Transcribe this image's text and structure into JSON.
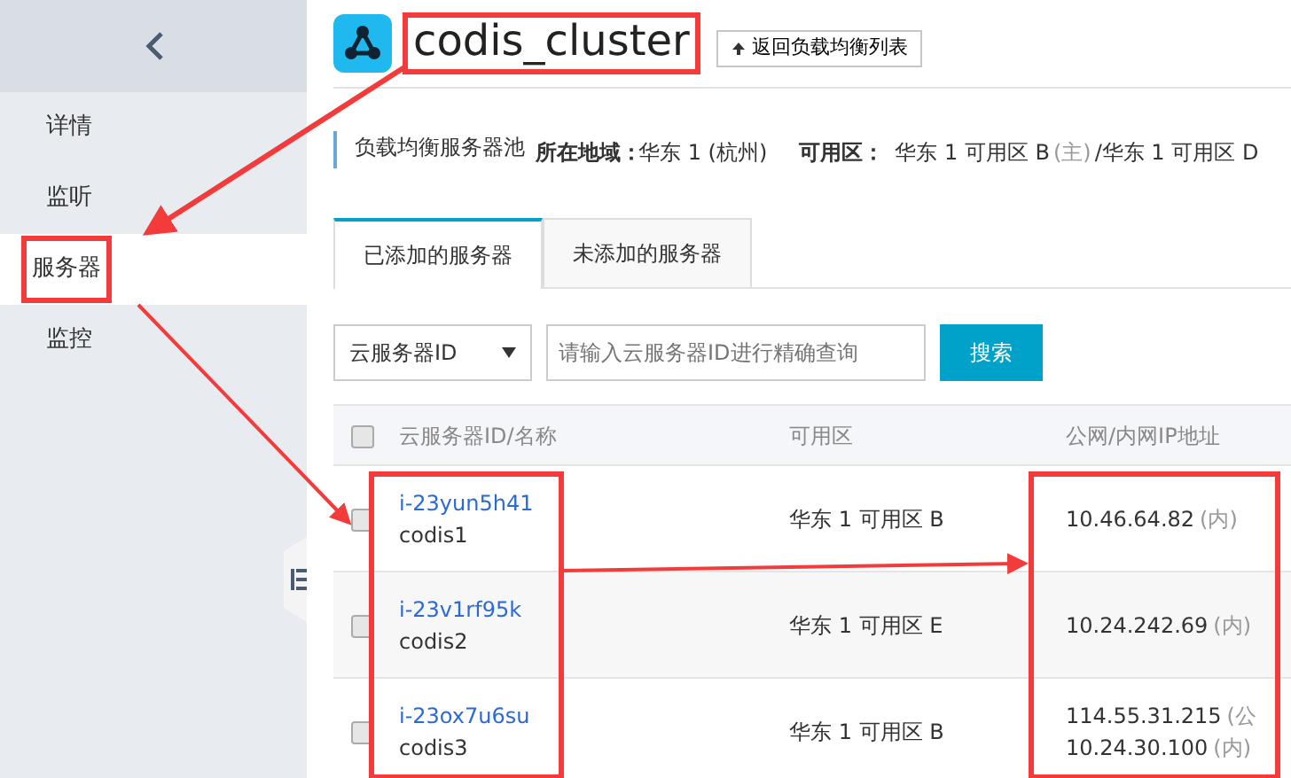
{
  "sidebar": {
    "items": [
      {
        "label": "详情",
        "selected": false,
        "highlighted": false
      },
      {
        "label": "监听",
        "selected": false,
        "highlighted": false
      },
      {
        "label": "服务器",
        "selected": true,
        "highlighted": true
      },
      {
        "label": "监控",
        "selected": false,
        "highlighted": false
      }
    ]
  },
  "header": {
    "title": "codis_cluster",
    "title_highlighted": true,
    "back_button": "返回负载均衡列表"
  },
  "info": {
    "pool_label": "负载均衡服务器池",
    "region_label": "所在地域：",
    "region": "华东 1 (杭州)",
    "zone_label": "可用区：",
    "zone_main": "华东 1 可用区 B",
    "zone_main_note": "(主)",
    "zone_rest": "/华东 1 可用区 D"
  },
  "tabs": [
    {
      "label": "已添加的服务器",
      "selected": true
    },
    {
      "label": "未添加的服务器",
      "selected": false
    }
  ],
  "filter": {
    "select": "云服务器ID",
    "placeholder": "请输入云服务器ID进行精确查询",
    "button": "搜索"
  },
  "table": {
    "select_all_checked": false,
    "columns": [
      {
        "label": "云服务器ID/名称",
        "highlighted": true
      },
      {
        "label": "可用区",
        "highlighted": false
      },
      {
        "label": "公网/内网IP地址",
        "highlighted": true
      }
    ],
    "rows": [
      {
        "checked": false,
        "id": "i-23yun5h41",
        "name": "codis1",
        "zone": "华东 1 可用区 B",
        "ips": [
          {
            "addr": "10.46.64.82",
            "tag": "(内)"
          }
        ]
      },
      {
        "checked": false,
        "id": "i-23v1rf95k",
        "name": "codis2",
        "zone": "华东 1 可用区 E",
        "ips": [
          {
            "addr": "10.24.242.69",
            "tag": "(内)"
          }
        ]
      },
      {
        "checked": false,
        "id": "i-23ox7u6su",
        "name": "codis3",
        "zone": "华东 1 可用区 B",
        "ips": [
          {
            "addr": "114.55.31.215",
            "tag": "(公"
          },
          {
            "addr": "10.24.30.100",
            "tag": "(内)"
          }
        ]
      }
    ]
  }
}
